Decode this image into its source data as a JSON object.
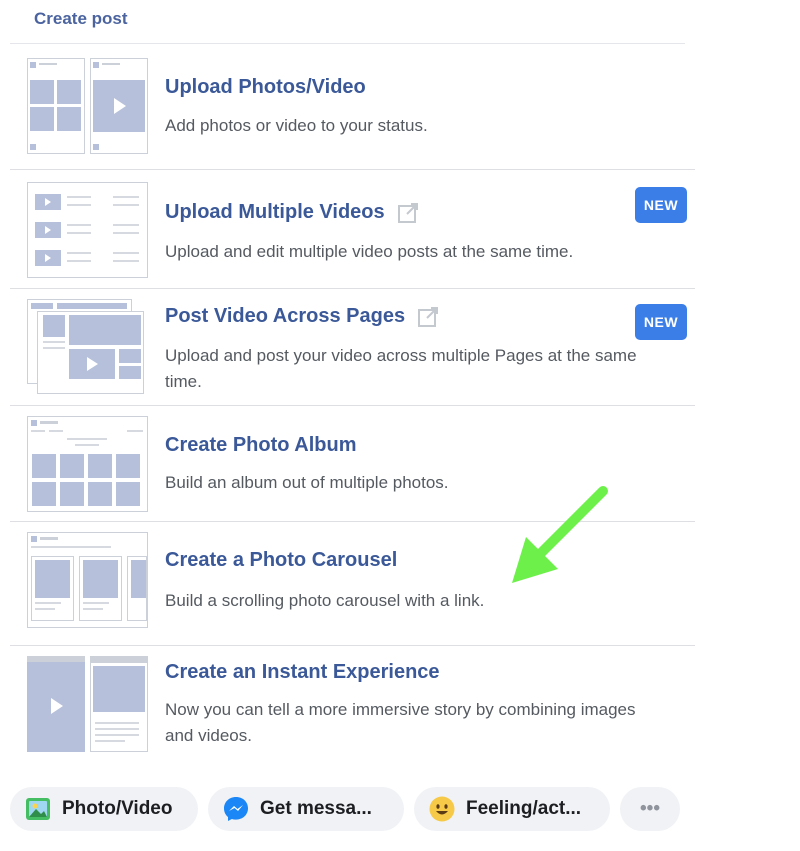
{
  "header": {
    "title": "Create post"
  },
  "rows": [
    {
      "title": "Upload Photos/Video",
      "desc": "Add photos or video to your status.",
      "external": false,
      "badge": ""
    },
    {
      "title": "Upload Multiple Videos",
      "desc": "Upload and edit multiple video posts at the same time.",
      "external": true,
      "badge": "NEW"
    },
    {
      "title": "Post Video Across Pages",
      "desc": "Upload and post your video across multiple Pages at the same time.",
      "external": true,
      "badge": "NEW"
    },
    {
      "title": "Create Photo Album",
      "desc": "Build an album out of multiple photos.",
      "external": false,
      "badge": ""
    },
    {
      "title": "Create a Photo Carousel",
      "desc": "Build a scrolling photo carousel with a link.",
      "external": false,
      "badge": ""
    },
    {
      "title": "Create an Instant Experience",
      "desc": "Now you can tell a more immersive story by combining images and videos.",
      "external": false,
      "badge": ""
    }
  ],
  "footer": {
    "photo_video": "Photo/Video",
    "get_messages": "Get messa...",
    "feeling": "Feeling/act...",
    "more": "•••"
  },
  "colors": {
    "accent": "#3b5998",
    "badge": "#3b7ee8",
    "annotation_arrow": "#6ef04a",
    "thumb_fill": "#b6c0db"
  }
}
